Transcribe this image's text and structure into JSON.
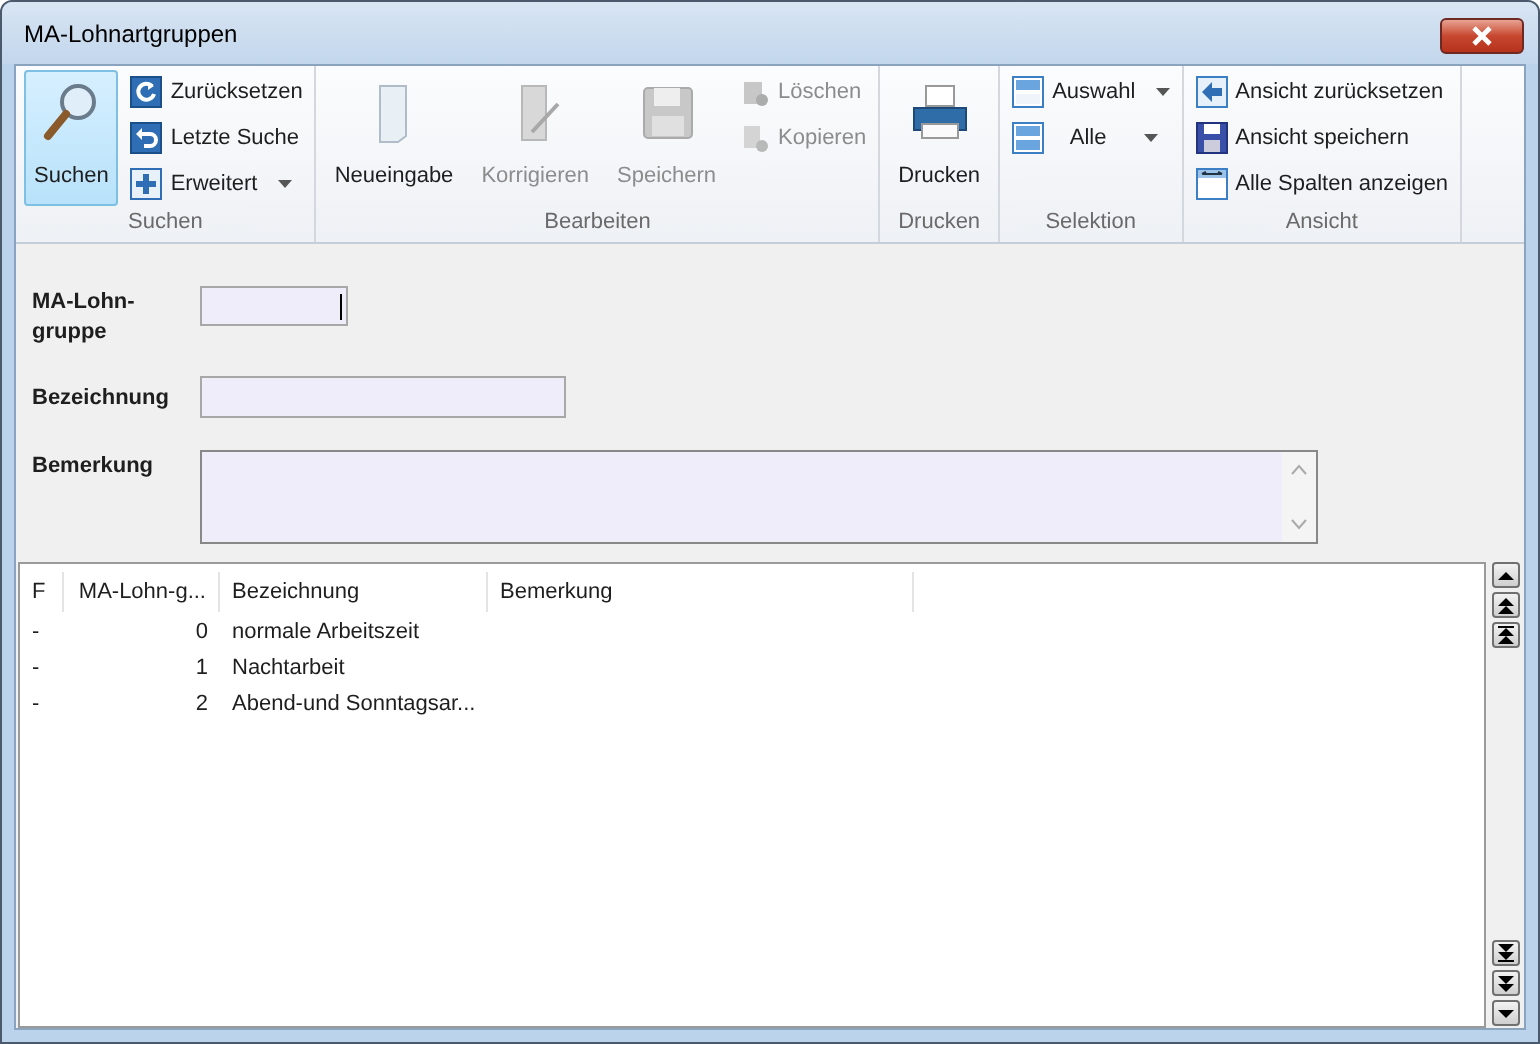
{
  "window": {
    "title": "MA-Lohnartgruppen"
  },
  "ribbon": {
    "groups": [
      {
        "label": "Suchen",
        "items": [
          {
            "kind": "large",
            "label": "Suchen",
            "selected": true,
            "disabled": false
          },
          {
            "kind": "small",
            "label": "Zurücksetzen",
            "disabled": false,
            "dropdown": false
          },
          {
            "kind": "small",
            "label": "Letzte Suche",
            "disabled": false,
            "dropdown": false
          },
          {
            "kind": "small",
            "label": "Erweitert",
            "disabled": false,
            "dropdown": true
          }
        ]
      },
      {
        "label": "Bearbeiten",
        "items": [
          {
            "kind": "large",
            "label": "Neueingabe",
            "selected": false,
            "disabled": false
          },
          {
            "kind": "large",
            "label": "Korrigieren",
            "selected": false,
            "disabled": true
          },
          {
            "kind": "large",
            "label": "Speichern",
            "selected": false,
            "disabled": true
          },
          {
            "kind": "small",
            "label": "Löschen",
            "disabled": true,
            "dropdown": false
          },
          {
            "kind": "small",
            "label": "Kopieren",
            "disabled": true,
            "dropdown": false
          }
        ]
      },
      {
        "label": "Drucken",
        "items": [
          {
            "kind": "large",
            "label": "Drucken",
            "selected": false,
            "disabled": false
          }
        ]
      },
      {
        "label": "Selektion",
        "items": [
          {
            "kind": "small",
            "label": "Auswahl",
            "disabled": false,
            "dropdown": true
          },
          {
            "kind": "small",
            "label": "Alle",
            "disabled": false,
            "dropdown": true
          }
        ]
      },
      {
        "label": "Ansicht",
        "items": [
          {
            "kind": "small",
            "label": "Ansicht zurücksetzen",
            "disabled": false,
            "dropdown": false
          },
          {
            "kind": "small",
            "label": "Ansicht speichern",
            "disabled": false,
            "dropdown": false
          },
          {
            "kind": "small",
            "label": "Alle Spalten anzeigen",
            "disabled": false,
            "dropdown": false
          }
        ]
      }
    ]
  },
  "form": {
    "fields": [
      {
        "kind": "short",
        "label": "MA-Lohn-gruppe"
      },
      {
        "kind": "medium",
        "label": "Bezeichnung"
      },
      {
        "kind": "memo",
        "label": "Bemerkung"
      }
    ]
  },
  "table": {
    "columns": [
      "F",
      "MA-Lohn-g...",
      "Bezeichnung",
      "Bemerkung"
    ],
    "rows": [
      [
        "-",
        "0",
        "normale Arbeitszeit",
        ""
      ],
      [
        "-",
        "1",
        "Nachtarbeit",
        ""
      ],
      [
        "-",
        "2",
        "Abend-und Sonntagsar...",
        ""
      ]
    ]
  }
}
